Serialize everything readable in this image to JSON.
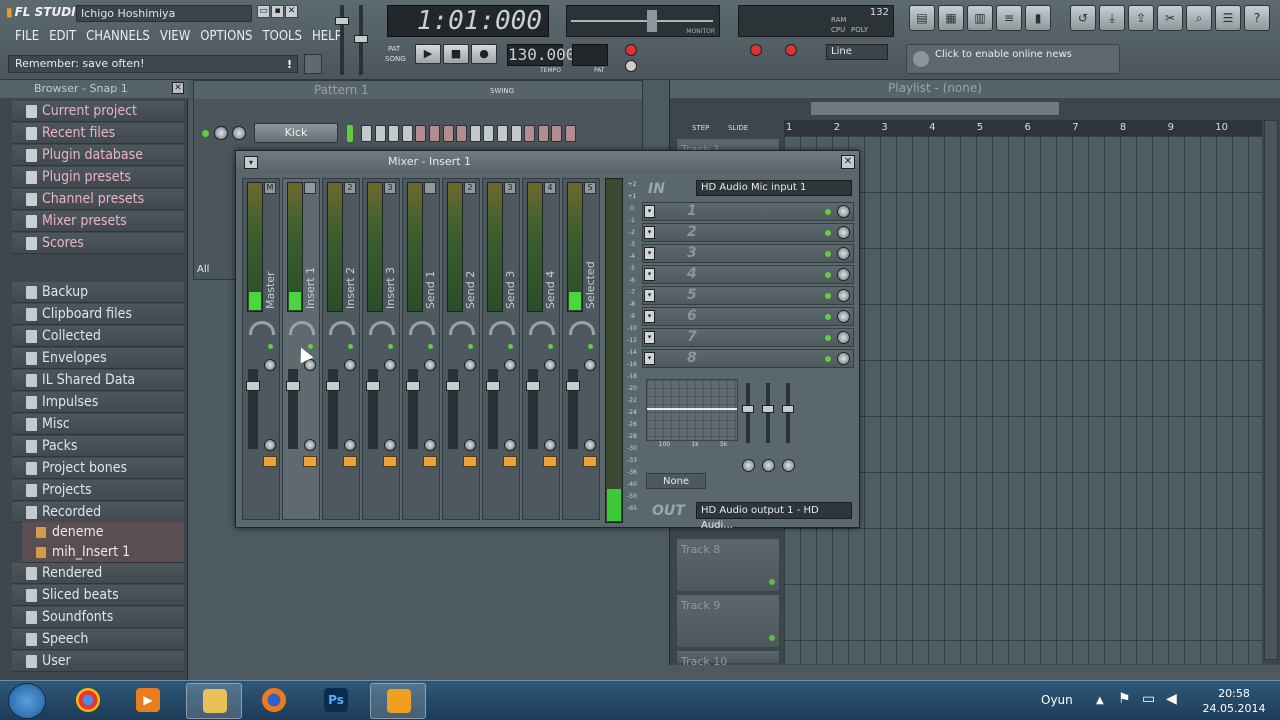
{
  "app": {
    "logo": "FL STUDIO",
    "song_title": "Ichigo Hoshimiya",
    "menu": [
      "FILE",
      "EDIT",
      "CHANNELS",
      "VIEW",
      "OPTIONS",
      "TOOLS",
      "HELP"
    ],
    "hint": "Remember: save often!",
    "time_display": "1:01:000",
    "tempo": "130.000",
    "tempo_label": "TEMPO",
    "pat_label": "PAT",
    "song_label": "SONG",
    "monitor_label": "MONITOR",
    "snap_select": "Line",
    "news_text": "Click to enable online news",
    "cpu_label": "CPU",
    "poly_label": "POLY",
    "ram_label": "RAM",
    "cpu_number": "132"
  },
  "browser": {
    "title": "Browser - Snap 1",
    "items": [
      {
        "label": "Current project",
        "kind": "special"
      },
      {
        "label": "Recent files",
        "kind": "special"
      },
      {
        "label": "Plugin database",
        "kind": "special"
      },
      {
        "label": "Plugin presets",
        "kind": "special"
      },
      {
        "label": "Channel presets",
        "kind": "special"
      },
      {
        "label": "Mixer presets",
        "kind": "special"
      },
      {
        "label": "Scores",
        "kind": "special"
      },
      {
        "label": "Backup",
        "kind": "folder"
      },
      {
        "label": "Clipboard files",
        "kind": "folder"
      },
      {
        "label": "Collected",
        "kind": "folder"
      },
      {
        "label": "Envelopes",
        "kind": "folder"
      },
      {
        "label": "IL Shared Data",
        "kind": "folder"
      },
      {
        "label": "Impulses",
        "kind": "folder"
      },
      {
        "label": "Misc",
        "kind": "folder"
      },
      {
        "label": "Packs",
        "kind": "folder"
      },
      {
        "label": "Project bones",
        "kind": "folder"
      },
      {
        "label": "Projects",
        "kind": "folder"
      },
      {
        "label": "Recorded",
        "kind": "folder"
      },
      {
        "label": "deneme",
        "kind": "sub"
      },
      {
        "label": "mih_Insert 1",
        "kind": "sub"
      },
      {
        "label": "Rendered",
        "kind": "folder"
      },
      {
        "label": "Sliced beats",
        "kind": "folder"
      },
      {
        "label": "Soundfonts",
        "kind": "folder"
      },
      {
        "label": "Speech",
        "kind": "folder"
      },
      {
        "label": "User",
        "kind": "folder"
      }
    ]
  },
  "rack": {
    "pattern": "Pattern 1",
    "swing_label": "SWING",
    "channel": "Kick",
    "filter": "All",
    "steps": 16
  },
  "playlist": {
    "title": "Playlist - (none)",
    "step_label": "STEP",
    "slide_label": "SLIDE",
    "ruler": [
      "1",
      "2",
      "3",
      "4",
      "5",
      "6",
      "7",
      "8",
      "9",
      "10"
    ],
    "tracks": [
      {
        "label": "Track 1"
      },
      {
        "label": "Track 8"
      },
      {
        "label": "Track 9"
      },
      {
        "label": "Track 10"
      }
    ]
  },
  "mixer": {
    "title": "Mixer - Insert 1",
    "strips": [
      {
        "name": "Master",
        "route": "M",
        "lit": true
      },
      {
        "name": "Insert 1",
        "route": "",
        "lit": true,
        "selected": true
      },
      {
        "name": "Insert 2",
        "route": "2",
        "lit": false
      },
      {
        "name": "Insert 3",
        "route": "3",
        "lit": false
      },
      {
        "name": "Send 1",
        "route": "",
        "lit": false
      },
      {
        "name": "Send 2",
        "route": "2",
        "lit": false
      },
      {
        "name": "Send 3",
        "route": "3",
        "lit": false
      },
      {
        "name": "Send 4",
        "route": "4",
        "lit": false
      },
      {
        "name": "Selected",
        "route": "S",
        "lit": true
      }
    ],
    "db_scale": [
      "+2",
      "+1",
      "0",
      "-1",
      "-2",
      "-3",
      "-4",
      "-5",
      "-6",
      "-7",
      "-8",
      "-9",
      "-10",
      "-12",
      "-14",
      "-16",
      "-18",
      "-20",
      "-22",
      "-24",
      "-26",
      "-28",
      "-30",
      "-33",
      "-36",
      "-40",
      "-50",
      "-65"
    ],
    "in_label": "IN",
    "input_device": "HD Audio Mic input 1",
    "slots": [
      "1",
      "2",
      "3",
      "4",
      "5",
      "6",
      "7",
      "8"
    ],
    "eq_band_labels": [
      "100",
      "1k",
      "5k"
    ],
    "preset_select": "None",
    "out_label": "OUT",
    "output_device": "HD Audio output 1 - HD Audi..."
  },
  "taskbar": {
    "apps": [
      "chrome",
      "media-player",
      "explorer",
      "firefox",
      "photoshop",
      "fl-studio"
    ],
    "ps_text": "Ps",
    "language": "Oyun",
    "time": "20:58",
    "date": "24.05.2014"
  }
}
